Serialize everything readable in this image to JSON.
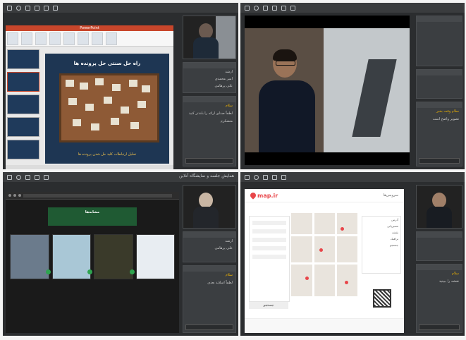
{
  "q1": {
    "toolbar_title": "",
    "ppt": {
      "app_title": "PowerPoint",
      "slide_title": "راه حل سنتی حل پرونده ها",
      "slide_caption": "تحلیل ارتباطات کلید حل شدن پرونده ها"
    },
    "users": [
      "ارشد",
      "امیر محمدی",
      "علی پرهامی"
    ],
    "chat": [
      "سلام",
      "لطفاً صدای ارائه را بلندتر کنید",
      "متشکرم"
    ]
  },
  "q2": {
    "toolbar_title": "",
    "chat": [
      "سلام وقت بخیر",
      "تصویر واضح است"
    ]
  },
  "q3": {
    "toolbar_title": "همایش جلسه و نمایشگاه آنلاین",
    "banner_title": "مشابه‌ها",
    "banner_sub": "",
    "users": [
      "ارشد",
      "علی پرهامی"
    ],
    "chat": [
      "سلام",
      "لطفاً اسلاید بعدی"
    ]
  },
  "q4": {
    "toolbar_title": "",
    "logo_text": "map.ir",
    "nav_text": "سرویس‌ها",
    "search_label": "جستجو",
    "list_items": [
      "آدرس",
      "مسیریابی",
      "نقشه",
      "ترافیک",
      "جستجو"
    ],
    "chat": [
      "سلام",
      "نقشه را ببینید"
    ]
  }
}
